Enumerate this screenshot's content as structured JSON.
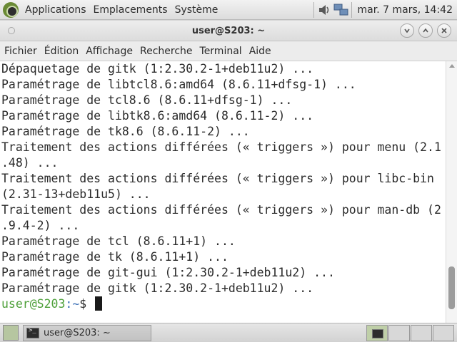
{
  "top_panel": {
    "menus": [
      "Applications",
      "Emplacements",
      "Système"
    ],
    "clock": "mar. 7 mars, 14:42",
    "icons": [
      "applications-logo-icon",
      "volume-icon",
      "network-icon"
    ]
  },
  "window": {
    "title": "user@S203: ~",
    "buttons": [
      "minimize",
      "maximize",
      "close"
    ],
    "menubar": [
      "Fichier",
      "Édition",
      "Affichage",
      "Recherche",
      "Terminal",
      "Aide"
    ]
  },
  "terminal": {
    "lines": [
      "Dépaquetage de gitk (1:2.30.2-1+deb11u2) ...",
      "Paramétrage de libtcl8.6:amd64 (8.6.11+dfsg-1) ...",
      "Paramétrage de tcl8.6 (8.6.11+dfsg-1) ...",
      "Paramétrage de libtk8.6:amd64 (8.6.11-2) ...",
      "Paramétrage de tk8.6 (8.6.11-2) ...",
      "Traitement des actions différées (« triggers ») pour menu (2.1",
      ".48) ...",
      "Traitement des actions différées (« triggers ») pour libc-bin",
      "(2.31-13+deb11u5) ...",
      "Traitement des actions différées (« triggers ») pour man-db (2",
      ".9.4-2) ...",
      "Paramétrage de tcl (8.6.11+1) ...",
      "Paramétrage de tk (8.6.11+1) ...",
      "Paramétrage de git-gui (1:2.30.2-1+deb11u2) ...",
      "Paramétrage de gitk (1:2.30.2-1+deb11u2) ..."
    ],
    "prompt_user": "user@S203",
    "prompt_path": ":~",
    "prompt_symbol": "$ "
  },
  "taskbar": {
    "task_label": "user@S203: ~"
  }
}
